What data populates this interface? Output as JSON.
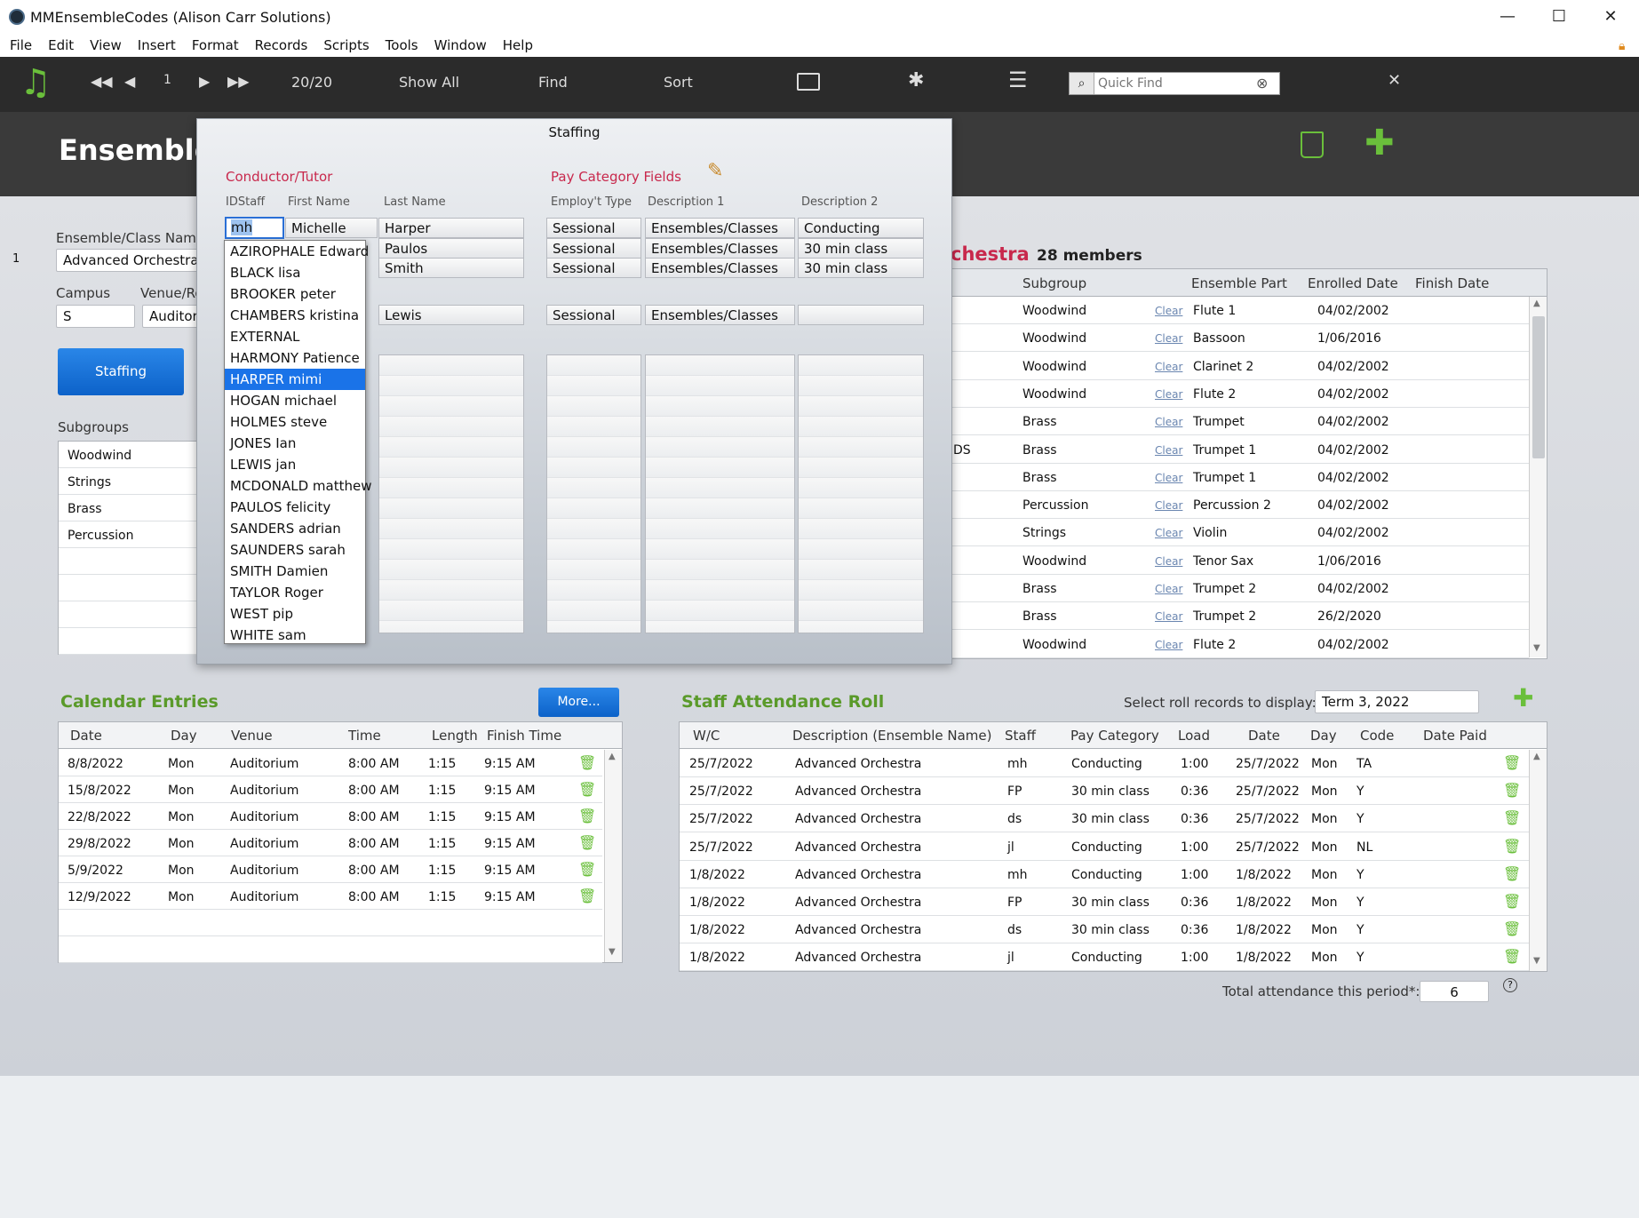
{
  "window": {
    "title": "MMEnsembleCodes (Alison Carr Solutions)",
    "minimize": "—",
    "maximize": "☐",
    "close": "✕"
  },
  "menu": [
    "File",
    "Edit",
    "View",
    "Insert",
    "Format",
    "Records",
    "Scripts",
    "Tools",
    "Window",
    "Help"
  ],
  "toolbar": {
    "record_num": "1",
    "record_count": "20/20",
    "show_all": "Show All",
    "find": "Find",
    "sort": "Sort",
    "quick_find_placeholder": "Quick Find"
  },
  "header": {
    "title": "Ensemble"
  },
  "form": {
    "record_index": "1",
    "ensemble_label": "Ensemble/Class Name",
    "ensemble_value": "Advanced Orchestra",
    "campus_label": "Campus",
    "campus_value": "S",
    "venue_label": "Venue/Ro",
    "venue_value": "Auditori",
    "staffing_button": "Staffing",
    "subgroups_label": "Subgroups",
    "subgroups": [
      "Woodwind",
      "Strings",
      "Brass",
      "Percussion",
      "",
      "",
      "",
      ""
    ]
  },
  "members": {
    "title_part": "chestra",
    "count": "28 members",
    "headers": {
      "subgroup": "Subgroup",
      "part": "Ensemble Part",
      "enrolled": "Enrolled Date",
      "finish": "Finish Date"
    },
    "clear_label": "Clear",
    "rows": [
      {
        "pre": "",
        "subgroup": "Woodwind",
        "part": "Flute 1",
        "enrolled": "04/02/2002"
      },
      {
        "pre": "",
        "subgroup": "Woodwind",
        "part": "Bassoon",
        "enrolled": "1/06/2016"
      },
      {
        "pre": "",
        "subgroup": "Woodwind",
        "part": "Clarinet 2",
        "enrolled": "04/02/2002"
      },
      {
        "pre": "",
        "subgroup": "Woodwind",
        "part": "Flute 2",
        "enrolled": "04/02/2002"
      },
      {
        "pre": "",
        "subgroup": "Brass",
        "part": "Trumpet",
        "enrolled": "04/02/2002"
      },
      {
        "pre": "DS",
        "subgroup": "Brass",
        "part": "Trumpet 1",
        "enrolled": "04/02/2002"
      },
      {
        "pre": "",
        "subgroup": "Brass",
        "part": "Trumpet 1",
        "enrolled": "04/02/2002"
      },
      {
        "pre": "",
        "subgroup": "Percussion",
        "part": "Percussion 2",
        "enrolled": "04/02/2002"
      },
      {
        "pre": "",
        "subgroup": "Strings",
        "part": "Violin",
        "enrolled": "04/02/2002"
      },
      {
        "pre": "",
        "subgroup": "Woodwind",
        "part": "Tenor Sax",
        "enrolled": "1/06/2016"
      },
      {
        "pre": "",
        "subgroup": "Brass",
        "part": "Trumpet 2",
        "enrolled": "04/02/2002"
      },
      {
        "pre": "",
        "subgroup": "Brass",
        "part": "Trumpet 2",
        "enrolled": "26/2/2020"
      },
      {
        "pre": "",
        "subgroup": "Woodwind",
        "part": "Flute 2",
        "enrolled": "04/02/2002"
      }
    ]
  },
  "staffing": {
    "title": "Staffing",
    "conductor_label": "Conductor/Tutor",
    "pay_label": "Pay Category Fields",
    "headers": {
      "id": "IDStaff",
      "first": "First Name",
      "last": "Last Name",
      "type": "Employ't Type",
      "desc1": "Description 1",
      "desc2": "Description 2"
    },
    "id_value": "mh",
    "rows": [
      {
        "first": "Michelle",
        "last": "Harper",
        "type": "Sessional",
        "desc1": "Ensembles/Classes",
        "desc2": "Conducting"
      },
      {
        "first": "",
        "last": "Paulos",
        "type": "Sessional",
        "desc1": "Ensembles/Classes",
        "desc2": "30 min class"
      },
      {
        "first": "",
        "last": "Smith",
        "type": "Sessional",
        "desc1": "Ensembles/Classes",
        "desc2": "30 min class"
      }
    ],
    "row4": {
      "last": "Lewis",
      "type": "Sessional",
      "desc1": "Ensembles/Classes",
      "desc2": ""
    },
    "dropdown": [
      "AZIROPHALE Edward",
      "BLACK lisa",
      "BROOKER peter",
      "CHAMBERS kristina",
      "EXTERNAL",
      "HARMONY Patience",
      "HARPER mimi",
      "HOGAN michael",
      "HOLMES steve",
      "JONES Ian",
      "LEWIS jan",
      "MCDONALD matthew",
      "PAULOS felicity",
      "SANDERS adrian",
      "SAUNDERS sarah",
      "SMITH Damien",
      "TAYLOR Roger",
      "WEST pip",
      "WHITE sam"
    ],
    "dropdown_selected": "HARPER mimi"
  },
  "calendar": {
    "title": "Calendar Entries",
    "more_button": "More...",
    "headers": {
      "date": "Date",
      "day": "Day",
      "venue": "Venue",
      "time": "Time",
      "length": "Length",
      "finish": "Finish Time"
    },
    "rows": [
      {
        "date": "8/8/2022",
        "day": "Mon",
        "venue": "Auditorium",
        "time": "8:00 AM",
        "length": "1:15",
        "finish": "9:15 AM"
      },
      {
        "date": "15/8/2022",
        "day": "Mon",
        "venue": "Auditorium",
        "time": "8:00 AM",
        "length": "1:15",
        "finish": "9:15 AM"
      },
      {
        "date": "22/8/2022",
        "day": "Mon",
        "venue": "Auditorium",
        "time": "8:00 AM",
        "length": "1:15",
        "finish": "9:15 AM"
      },
      {
        "date": "29/8/2022",
        "day": "Mon",
        "venue": "Auditorium",
        "time": "8:00 AM",
        "length": "1:15",
        "finish": "9:15 AM"
      },
      {
        "date": "5/9/2022",
        "day": "Mon",
        "venue": "Auditorium",
        "time": "8:00 AM",
        "length": "1:15",
        "finish": "9:15 AM"
      },
      {
        "date": "12/9/2022",
        "day": "Mon",
        "venue": "Auditorium",
        "time": "8:00 AM",
        "length": "1:15",
        "finish": "9:15 AM"
      }
    ]
  },
  "attendance": {
    "title": "Staff Attendance Roll",
    "select_label": "Select roll records to display:",
    "select_value": "Term 3, 2022",
    "headers": {
      "wc": "W/C",
      "desc": "Description (Ensemble Name)",
      "staff": "Staff",
      "pay": "Pay Category",
      "load": "Load",
      "date": "Date",
      "day": "Day",
      "code": "Code",
      "paid": "Date Paid"
    },
    "rows": [
      {
        "wc": "25/7/2022",
        "desc": "Advanced Orchestra",
        "staff": "mh",
        "pay": "Conducting",
        "load": "1:00",
        "date": "25/7/2022",
        "day": "Mon",
        "code": "TA"
      },
      {
        "wc": "25/7/2022",
        "desc": "Advanced Orchestra",
        "staff": "FP",
        "pay": "30 min class",
        "load": "0:36",
        "date": "25/7/2022",
        "day": "Mon",
        "code": "Y"
      },
      {
        "wc": "25/7/2022",
        "desc": "Advanced Orchestra",
        "staff": "ds",
        "pay": "30 min class",
        "load": "0:36",
        "date": "25/7/2022",
        "day": "Mon",
        "code": "Y"
      },
      {
        "wc": "25/7/2022",
        "desc": "Advanced Orchestra",
        "staff": "jl",
        "pay": "Conducting",
        "load": "1:00",
        "date": "25/7/2022",
        "day": "Mon",
        "code": "NL"
      },
      {
        "wc": "1/8/2022",
        "desc": "Advanced Orchestra",
        "staff": "mh",
        "pay": "Conducting",
        "load": "1:00",
        "date": "1/8/2022",
        "day": "Mon",
        "code": "Y"
      },
      {
        "wc": "1/8/2022",
        "desc": "Advanced Orchestra",
        "staff": "FP",
        "pay": "30 min class",
        "load": "0:36",
        "date": "1/8/2022",
        "day": "Mon",
        "code": "Y"
      },
      {
        "wc": "1/8/2022",
        "desc": "Advanced Orchestra",
        "staff": "ds",
        "pay": "30 min class",
        "load": "0:36",
        "date": "1/8/2022",
        "day": "Mon",
        "code": "Y"
      },
      {
        "wc": "1/8/2022",
        "desc": "Advanced Orchestra",
        "staff": "jl",
        "pay": "Conducting",
        "load": "1:00",
        "date": "1/8/2022",
        "day": "Mon",
        "code": "Y"
      }
    ],
    "total_label": "Total attendance this period*:",
    "total_value": "6",
    "help": "?"
  },
  "colors": {
    "accent": "#5a9a2a",
    "pink": "#c8284c",
    "blue": "#1a73e8",
    "dark": "#2b2b2b"
  }
}
